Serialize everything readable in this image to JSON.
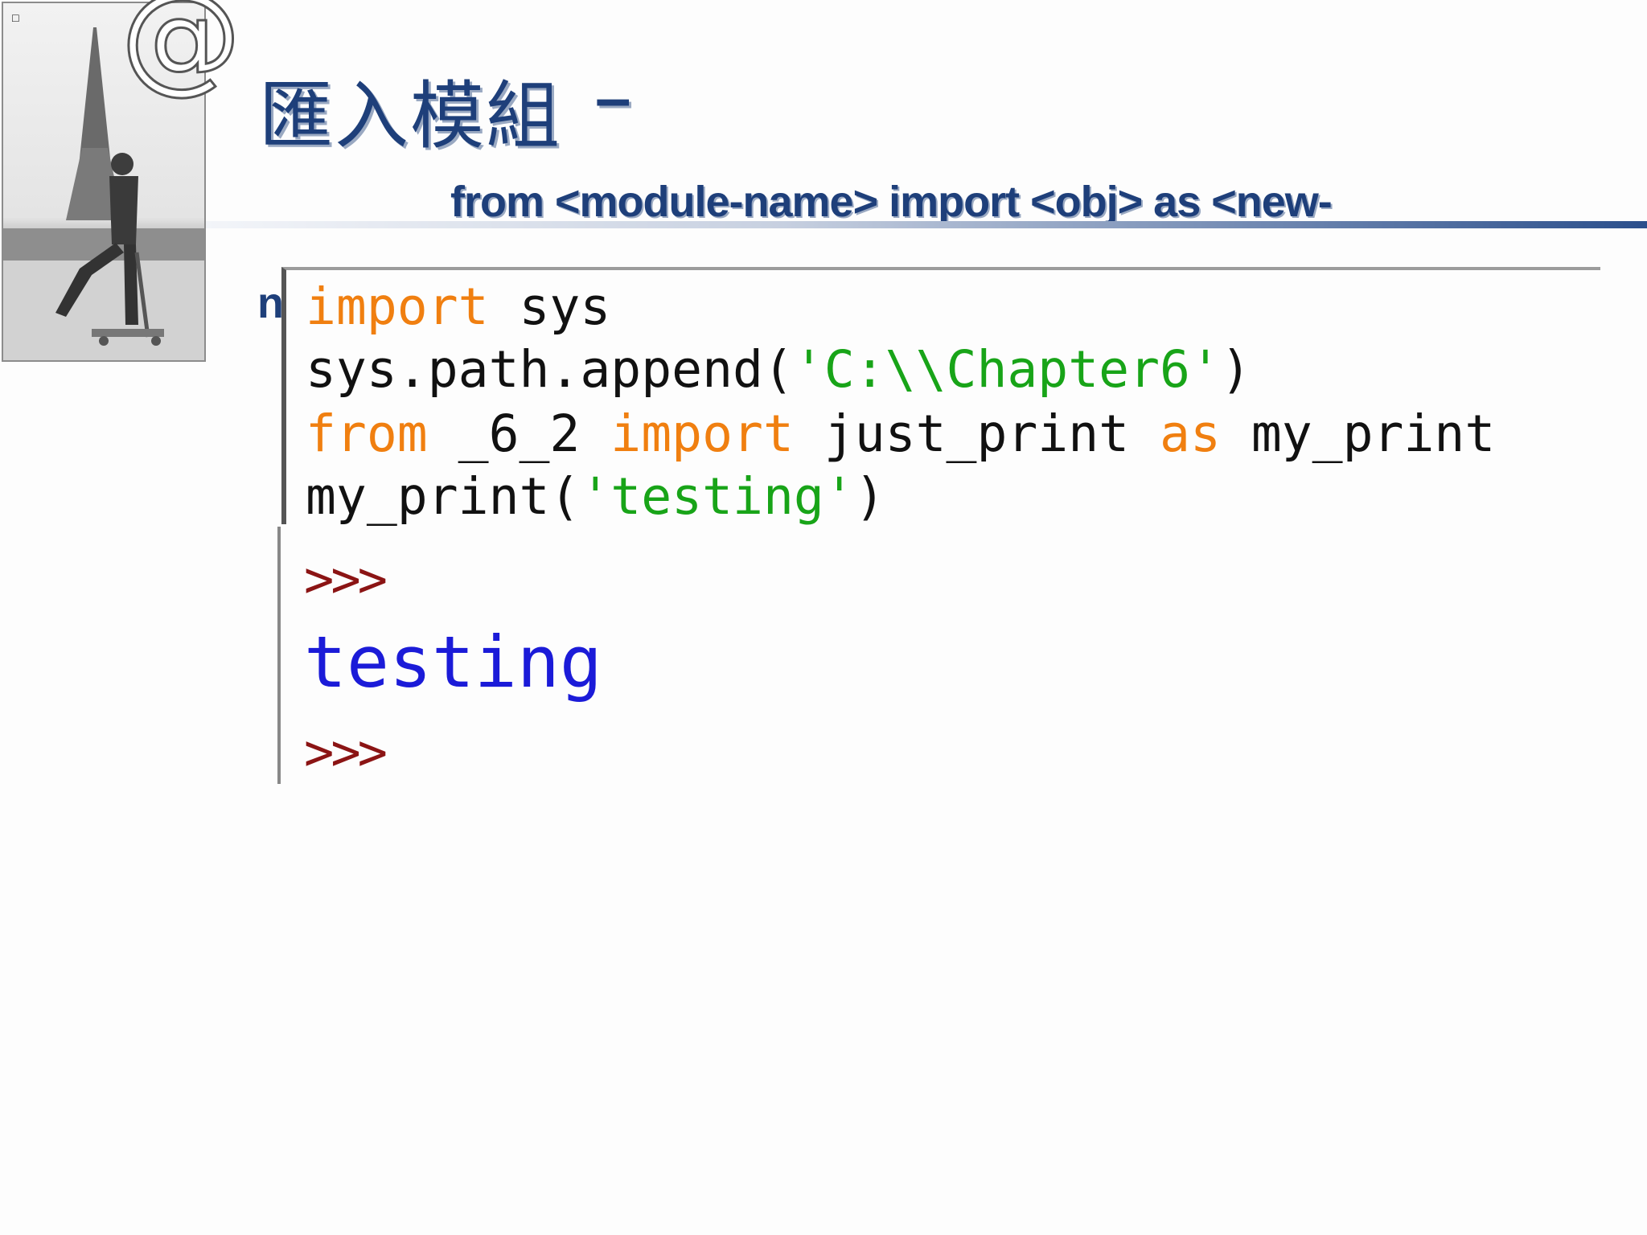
{
  "slide": {
    "title": "匯入模組",
    "title_dash": "–",
    "subtitle": "from <module-name> import <obj> as <new-",
    "stray_char": "n",
    "corner_glyph": "@",
    "small_icon": "☐"
  },
  "code": {
    "lines": [
      [
        {
          "t": "import",
          "c": "kw"
        },
        {
          "t": " sys",
          "c": "plain"
        }
      ],
      [
        {
          "t": "sys.path.append(",
          "c": "plain"
        },
        {
          "t": "'C:\\\\Chapter6'",
          "c": "str"
        },
        {
          "t": ")",
          "c": "plain"
        }
      ],
      [
        {
          "t": "from",
          "c": "kw"
        },
        {
          "t": " _6_2 ",
          "c": "plain"
        },
        {
          "t": "import",
          "c": "kw"
        },
        {
          "t": " just_print ",
          "c": "plain"
        },
        {
          "t": "as",
          "c": "kw"
        },
        {
          "t": " my_print",
          "c": "plain"
        }
      ],
      [
        {
          "t": "my_print(",
          "c": "plain"
        },
        {
          "t": "'testing'",
          "c": "str"
        },
        {
          "t": ")",
          "c": "plain"
        }
      ]
    ]
  },
  "shell": {
    "prompt1": ">>>",
    "output": "testing",
    "prompt2": ">>>"
  },
  "colors": {
    "title": "#1e3f7a",
    "keyword": "#f07f10",
    "string": "#18a418",
    "prompt": "#8b1414",
    "output": "#1b1bd8"
  }
}
